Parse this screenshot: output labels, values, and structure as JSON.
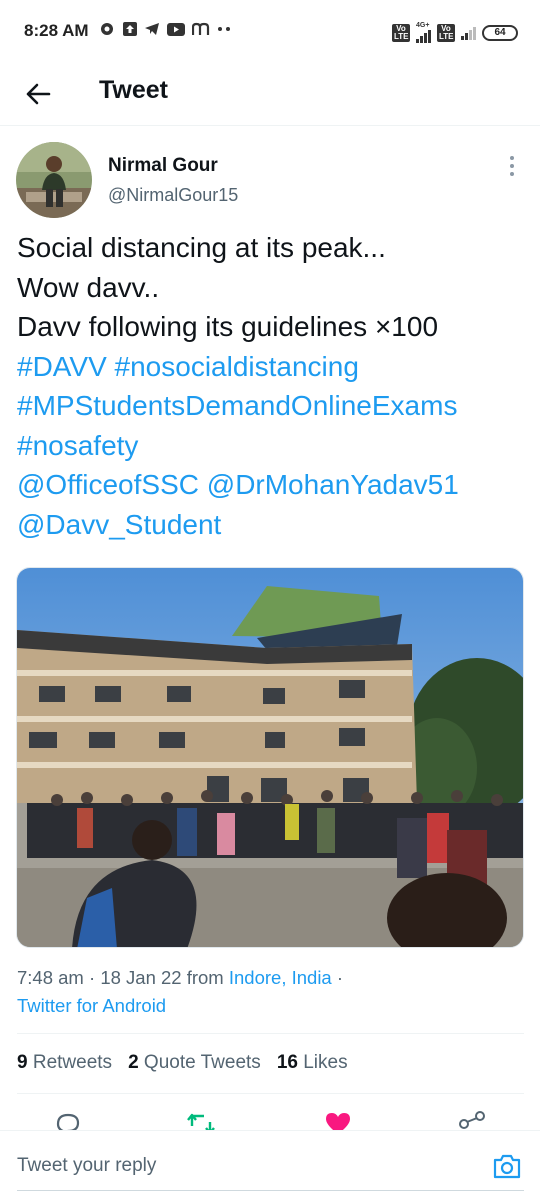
{
  "status_bar": {
    "time": "8:28 AM",
    "network_type": "4G+",
    "volte_label": "Vo LTE",
    "battery": "64"
  },
  "header": {
    "title": "Tweet"
  },
  "author": {
    "name": "Nirmal Gour",
    "handle": "@NirmalGour15"
  },
  "tweet": {
    "lines": [
      "Social distancing at its peak...",
      "Wow davv..",
      "Davv following its guidelines ×100"
    ],
    "hashtags": [
      "#DAVV",
      "#nosocialdistancing",
      "#MPStudentsDemandOnlineExams",
      "#nosafety"
    ],
    "mentions": [
      "@OfficeofSSC",
      "@DrMohanYadav51",
      "@Davv_Student"
    ]
  },
  "meta": {
    "time": "7:48 am",
    "date": "18 Jan 22",
    "from_label": "from",
    "location": "Indore, India",
    "client": "Twitter for Android"
  },
  "stats": {
    "retweets_count": "9",
    "retweets_label": "Retweets",
    "quotes_count": "2",
    "quotes_label": "Quote Tweets",
    "likes_count": "16",
    "likes_label": "Likes"
  },
  "actions": {
    "reply_icon": "reply-icon",
    "retweet_icon": "retweet-icon",
    "like_icon": "heart-icon",
    "share_icon": "share-icon",
    "retweet_color": "#00ba7c",
    "like_color": "#f91880"
  },
  "reply_bar": {
    "placeholder": "Tweet your reply"
  },
  "colors": {
    "accent": "#1d9bf0",
    "text": "#0f1419",
    "muted": "#536471"
  }
}
